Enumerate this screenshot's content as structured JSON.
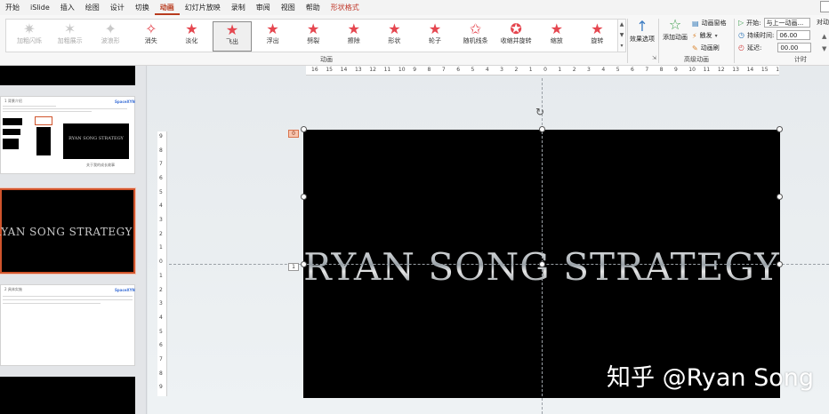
{
  "tabs": [
    {
      "label": "开始",
      "active": false
    },
    {
      "label": "iSlide",
      "active": false
    },
    {
      "label": "插入",
      "active": false
    },
    {
      "label": "绘图",
      "active": false
    },
    {
      "label": "设计",
      "active": false
    },
    {
      "label": "切换",
      "active": false
    },
    {
      "label": "动画",
      "active": true
    },
    {
      "label": "幻灯片放映",
      "active": false
    },
    {
      "label": "录制",
      "active": false
    },
    {
      "label": "审阅",
      "active": false
    },
    {
      "label": "视图",
      "active": false
    },
    {
      "label": "帮助",
      "active": false
    },
    {
      "label": "形状格式",
      "active": false,
      "contextual": true
    }
  ],
  "ribbon": {
    "effects": [
      {
        "label": "加粗闪烁",
        "disabled": true
      },
      {
        "label": "加粗展示",
        "disabled": true
      },
      {
        "label": "波浪形",
        "disabled": true
      },
      {
        "label": "消失",
        "disabled": false
      },
      {
        "label": "淡化",
        "disabled": false
      },
      {
        "label": "飞出",
        "disabled": false,
        "selected": true
      },
      {
        "label": "浮出",
        "disabled": false
      },
      {
        "label": "劈裂",
        "disabled": false
      },
      {
        "label": "擦除",
        "disabled": false
      },
      {
        "label": "形状",
        "disabled": false
      },
      {
        "label": "轮子",
        "disabled": false
      },
      {
        "label": "随机线条",
        "disabled": false
      },
      {
        "label": "收缩并旋转",
        "disabled": false
      },
      {
        "label": "缩放",
        "disabled": false
      },
      {
        "label": "旋转",
        "disabled": false
      }
    ],
    "animation_group_label": "动画",
    "effect_options_label": "效果选项",
    "add_animation_label": "添加动画",
    "animation_pane_label": "动画窗格",
    "trigger_label": "触发",
    "animation_painter_label": "动画刷",
    "advanced_group_label": "高级动画",
    "start_label": "开始:",
    "start_value": "与上一动画...",
    "duration_label": "持续时间:",
    "duration_value": "06.00",
    "delay_label": "延迟:",
    "delay_value": "00.00",
    "timing_group_label": "计时",
    "reorder_label": "对动"
  },
  "thumbnails": {
    "slide_title": "RYAN SONG STRATEGY",
    "mini_caption": "关于我的成长故事",
    "mini_logo": "SpaceXYN"
  },
  "hruler_ticks": [
    "16",
    "15",
    "14",
    "13",
    "12",
    "11",
    "10",
    "9",
    "8",
    "7",
    "6",
    "5",
    "4",
    "3",
    "2",
    "1",
    "0",
    "1",
    "2",
    "3",
    "4",
    "5",
    "6",
    "7",
    "8",
    "9",
    "10",
    "11",
    "12",
    "13",
    "14",
    "15",
    "16"
  ],
  "vruler_ticks": [
    "9",
    "8",
    "7",
    "6",
    "5",
    "4",
    "3",
    "2",
    "1",
    "0",
    "1",
    "2",
    "3",
    "4",
    "5",
    "6",
    "7",
    "8",
    "9"
  ],
  "slide": {
    "title": "RYAN  SONG  STRATEGY",
    "animation_tags": [
      "0",
      "1"
    ]
  },
  "watermark": "知乎 @Ryan Song"
}
